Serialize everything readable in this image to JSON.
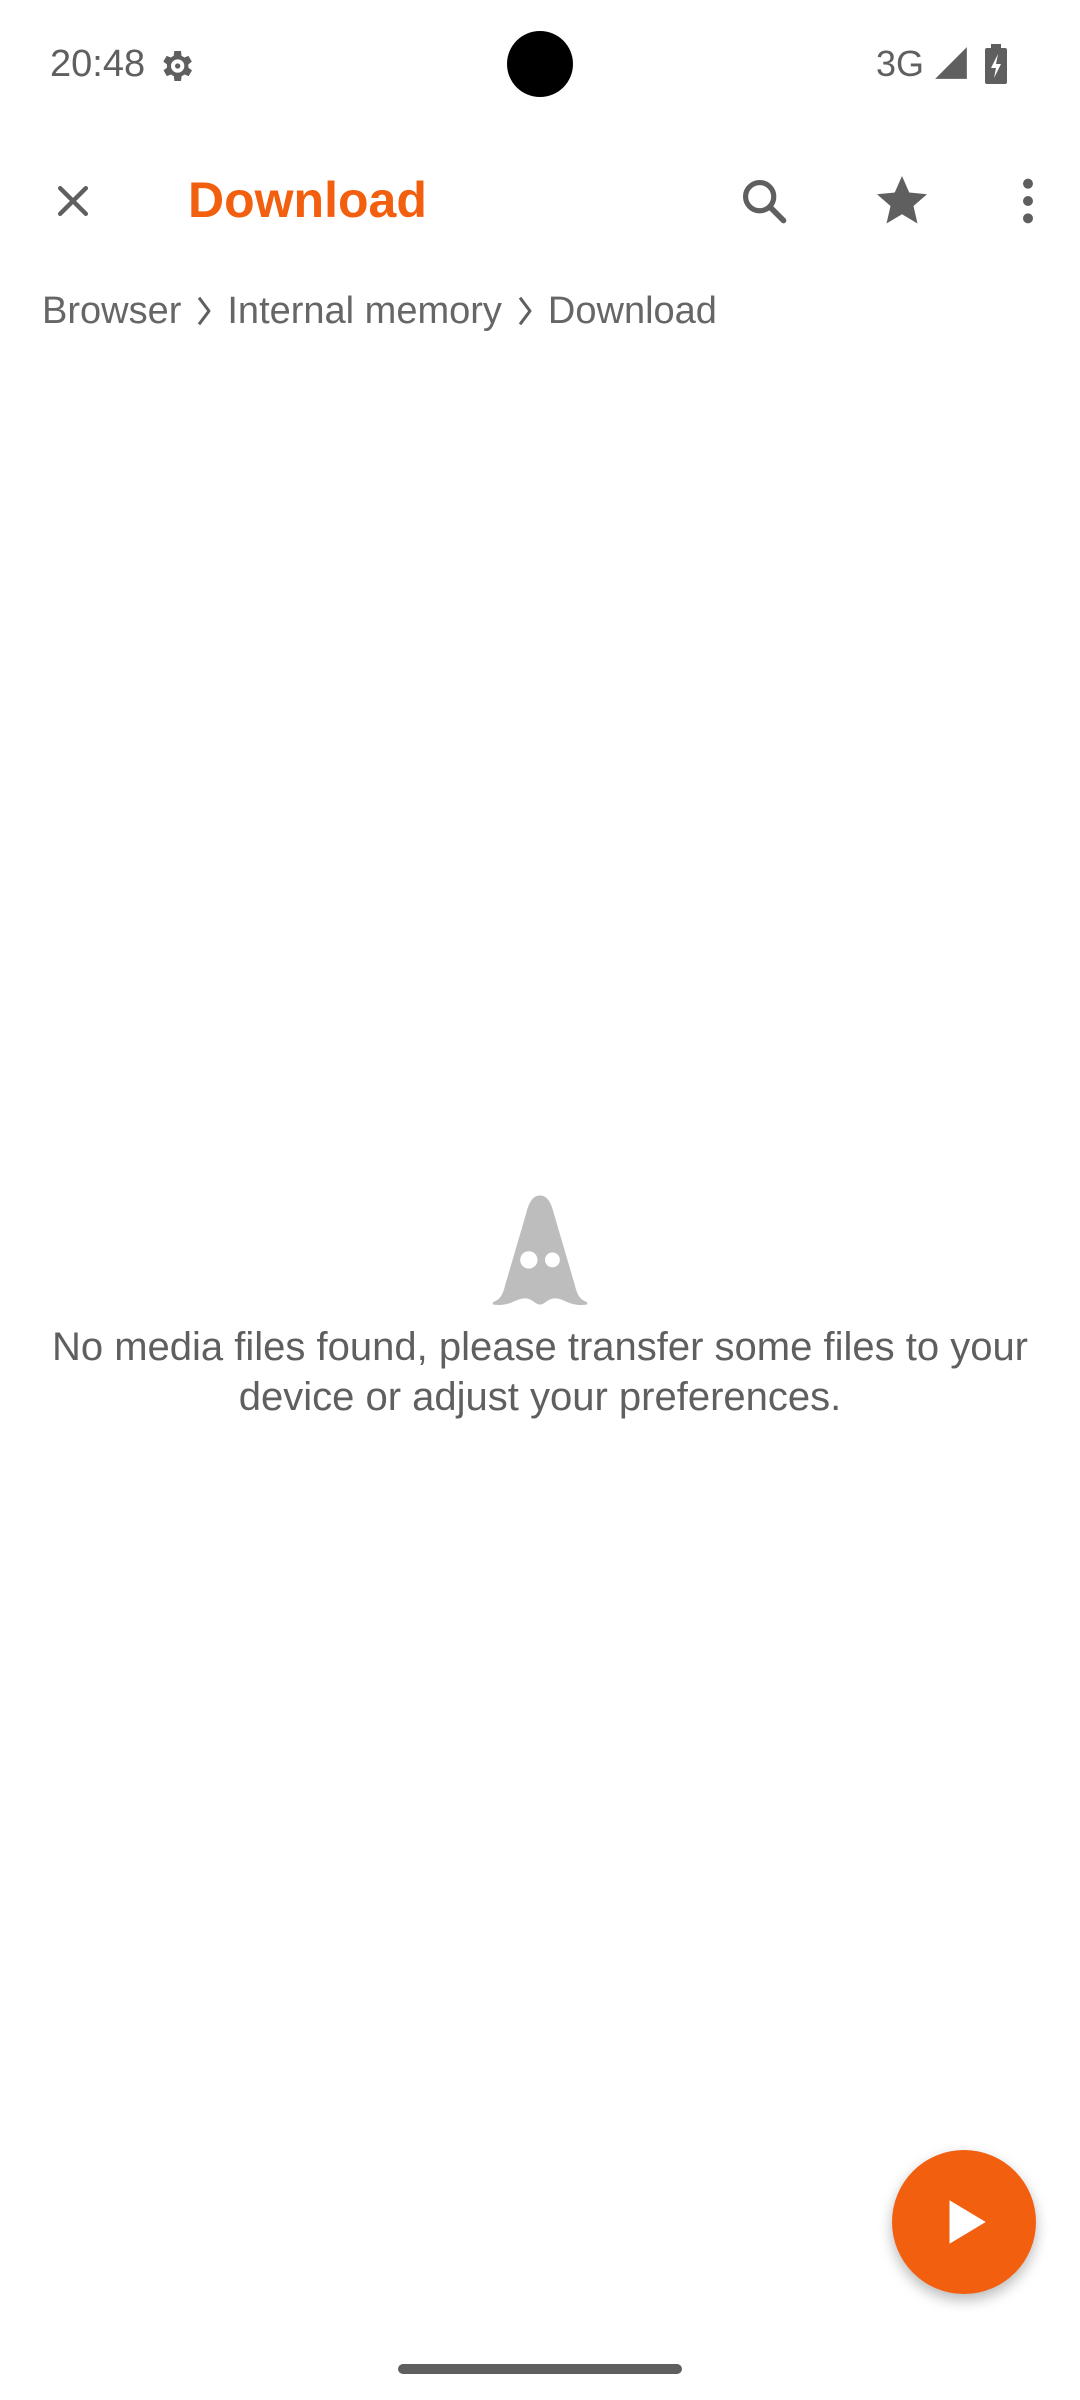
{
  "status_bar": {
    "time": "20:48",
    "network": "3G",
    "icons": [
      "settings-gear-icon",
      "signal-icon",
      "battery-charging-icon"
    ]
  },
  "toolbar": {
    "title": "Download",
    "close_icon": "close-icon",
    "search_icon": "search-icon",
    "favorite_icon": "star-icon",
    "more_icon": "more-vertical-icon"
  },
  "breadcrumb": {
    "items": [
      {
        "label": "Browser"
      },
      {
        "label": "Internal memory"
      },
      {
        "label": "Download"
      }
    ],
    "separator_icon": "chevron-right-icon"
  },
  "empty_state": {
    "icon": "vlc-cone-icon",
    "message": "No media files found, please transfer some files to your device or adjust your preferences."
  },
  "fab": {
    "icon": "play-icon"
  },
  "colors": {
    "accent": "#f25f0f",
    "text_secondary": "#5f5f5f",
    "icon_gray": "#bdbdbd"
  }
}
